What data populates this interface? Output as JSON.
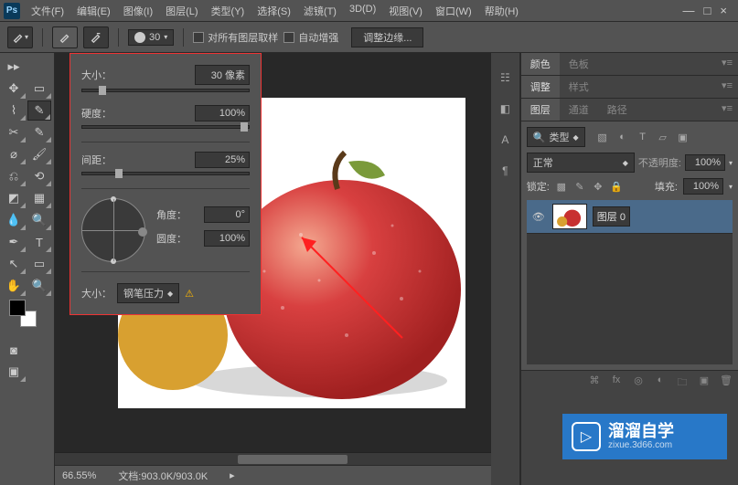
{
  "app": {
    "logo": "Ps"
  },
  "menu": {
    "file": "文件(F)",
    "edit": "编辑(E)",
    "image": "图像(I)",
    "layer": "图层(L)",
    "type": "类型(Y)",
    "select": "选择(S)",
    "filter": "滤镜(T)",
    "threed": "3D(D)",
    "view": "视图(V)",
    "window": "窗口(W)",
    "help": "帮助(H)"
  },
  "window_controls": {
    "min": "—",
    "max": "□",
    "close": "×"
  },
  "options": {
    "brush_size_num": "30",
    "sample_all": "对所有图层取样",
    "auto_enhance": "自动增强",
    "refine_edge": "调整边缘..."
  },
  "brush_panel": {
    "size_label": "大小：",
    "size_value": "30 像素",
    "hardness_label": "硬度：",
    "hardness_value": "100%",
    "spacing_label": "间距：",
    "spacing_value": "25%",
    "angle_label": "角度：",
    "angle_value": "0°",
    "roundness_label": "圆度：",
    "roundness_value": "100%",
    "footer_label": "大小：",
    "footer_select": "钢笔压力",
    "warn": "⚠"
  },
  "panels": {
    "color_tab": "颜色",
    "swatches_tab": "色板",
    "adjust_tab": "调整",
    "styles_tab": "样式",
    "layers_tab": "图层",
    "channels_tab": "通道",
    "paths_tab": "路径",
    "kind_label": "类型",
    "blend_mode": "正常",
    "opacity_label": "不透明度:",
    "opacity_value": "100%",
    "lock_label": "锁定:",
    "fill_label": "填充:",
    "fill_value": "100%",
    "layer0_name": "图层 0"
  },
  "status": {
    "zoom": "66.55%",
    "doc": "文档:903.0K/903.0K"
  },
  "watermark": {
    "title": "溜溜自学",
    "url": "zixue.3d66.com"
  }
}
